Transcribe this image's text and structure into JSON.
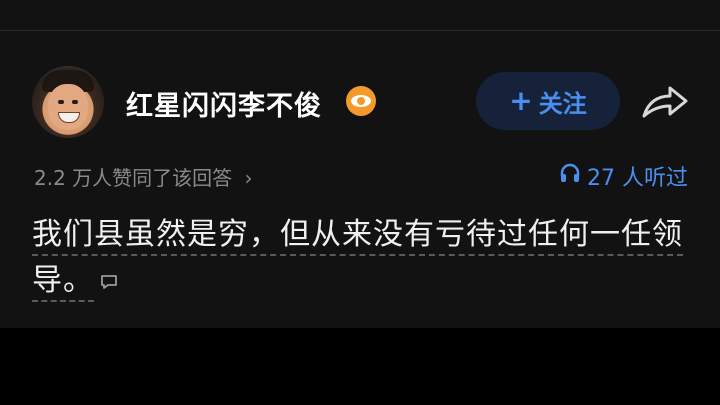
{
  "author": {
    "name": "红星闪闪李不俊",
    "badge_icon": "eye-badge-icon"
  },
  "follow_button": {
    "label": "关注",
    "icon": "plus-icon"
  },
  "share_icon": "share-arrow-icon",
  "meta": {
    "likes_text": "2.2 万人赞同了该回答",
    "likes_arrow": "›",
    "listen_icon": "headphones-icon",
    "listen_text": "27 人听过"
  },
  "answer": {
    "text": "我们县虽然是穷，但从来没有亏待过任何一任领导。",
    "comment_icon": "comment-icon"
  },
  "colors": {
    "accent": "#4a8ff0",
    "badge": "#f39a2b",
    "card_bg": "#121212",
    "follow_bg": "#16223a"
  }
}
